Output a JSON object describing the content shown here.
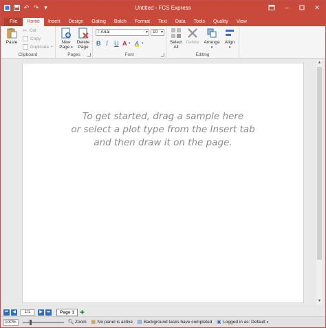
{
  "window": {
    "title": "Untitled - FCS Express"
  },
  "tabs": [
    {
      "label": "File"
    },
    {
      "label": "Home"
    },
    {
      "label": "Insert"
    },
    {
      "label": "Design"
    },
    {
      "label": "Gating"
    },
    {
      "label": "Batch"
    },
    {
      "label": "Format"
    },
    {
      "label": "Text"
    },
    {
      "label": "Data"
    },
    {
      "label": "Tools"
    },
    {
      "label": "Quality"
    },
    {
      "label": "View"
    }
  ],
  "ribbon": {
    "clipboard": {
      "label": "Clipboard",
      "paste": "Paste",
      "cut": "Cut",
      "copy": "Copy",
      "duplicate": "Duplicate"
    },
    "pages": {
      "label": "Pages",
      "new_page": [
        "New",
        "Page"
      ],
      "delete_page": [
        "Delete",
        "Page"
      ]
    },
    "font": {
      "label": "Font",
      "family": "Arial",
      "size": "10",
      "bold": "B",
      "italic": "I",
      "underline": "U",
      "font_color": "A",
      "highlight": "A"
    },
    "editing": {
      "label": "Editing",
      "select_all": [
        "Select",
        "All"
      ],
      "delete": "Delete",
      "arrange": "Arrange",
      "align": "Align"
    }
  },
  "canvas": {
    "hint_lines": [
      "To get started, drag a sample here",
      "or select a plot type from the Insert tab",
      "and then draw it on the page."
    ]
  },
  "pagenav": {
    "page_counter": "1/1",
    "page_tab": "Page 1"
  },
  "statusbar": {
    "zoom_value": "100%",
    "zoom_label": "Zoom",
    "panel_status": "No panel is active",
    "background_status": "Background tasks have completed",
    "login_status": "Logged in as: Default"
  },
  "colors": {
    "accent": "#c94a3b",
    "tab_active_text": "#c94a3b",
    "hint_text": "#8a8a8a",
    "nav_blue": "#2f6fba"
  },
  "icons": {
    "qat": [
      "app-icon",
      "save-icon",
      "undo-icon",
      "redo-icon",
      "qat-customize-icon"
    ],
    "window": [
      "options-icon",
      "minimize-icon",
      "maximize-icon",
      "close-icon"
    ]
  }
}
